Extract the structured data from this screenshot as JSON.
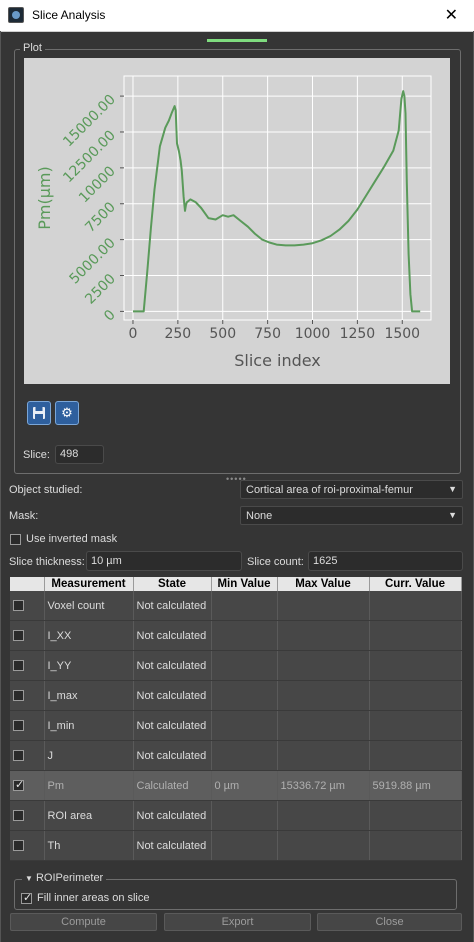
{
  "window": {
    "title": "Slice Analysis",
    "close_glyph": "✕"
  },
  "plot": {
    "group_title": "Plot",
    "slice_label": "Slice:",
    "slice_value": "498",
    "save_icon": "save-icon",
    "settings_icon": "gear-icon"
  },
  "chart_data": {
    "type": "line",
    "xlabel": "Slice index",
    "ylabel": "Pm(µm)",
    "xlim": [
      -50,
      1660
    ],
    "ylim": [
      -600,
      16400
    ],
    "x_ticks": [
      0,
      250,
      500,
      750,
      1000,
      1250,
      1500
    ],
    "y_ticks": [
      0,
      2500,
      5000,
      7500,
      10000,
      12500,
      15000
    ],
    "y_tick_labels": [
      "0",
      "2500",
      "5000.00",
      "7500",
      "10000",
      "12500.00",
      "15000.00"
    ],
    "grid": true,
    "color": "#5a9a5a",
    "series": [
      {
        "x": [
          0,
          60,
          80,
          100,
          120,
          150,
          180,
          200,
          215,
          225,
          232,
          238,
          245,
          255,
          265,
          272,
          282,
          290,
          295,
          300,
          320,
          350,
          380,
          420,
          460,
          500,
          530,
          560,
          600,
          640,
          680,
          720,
          760,
          800,
          850,
          900,
          950,
          1000,
          1050,
          1100,
          1150,
          1200,
          1250,
          1300,
          1350,
          1400,
          1450,
          1480,
          1495,
          1505,
          1512,
          1518,
          1525,
          1535,
          1545,
          1555,
          1565,
          1575,
          1600
        ],
        "y": [
          0,
          0,
          2800,
          5800,
          8500,
          11500,
          12800,
          13300,
          13800,
          14100,
          14300,
          14000,
          11700,
          11200,
          10500,
          9800,
          8000,
          7000,
          7400,
          7600,
          7800,
          7600,
          7200,
          6500,
          6400,
          6700,
          6600,
          6700,
          6300,
          5900,
          5400,
          5000,
          4800,
          4650,
          4600,
          4600,
          4650,
          4750,
          4950,
          5250,
          5700,
          6300,
          7100,
          8100,
          9100,
          10100,
          11200,
          12600,
          14800,
          15350,
          15000,
          13800,
          9000,
          4000,
          1200,
          0,
          0,
          0,
          0
        ]
      }
    ]
  },
  "controls": {
    "object_label": "Object studied:",
    "object_value": "Cortical area of roi-proximal-femur",
    "mask_label": "Mask:",
    "mask_value": "None",
    "inverted_label": "Use inverted mask",
    "thickness_label": "Slice thickness:",
    "thickness_value": "10 µm",
    "count_label": "Slice count:",
    "count_value": "1625"
  },
  "table": {
    "headers": [
      "Measurement",
      "State",
      "Min Value",
      "Max Value",
      "Curr. Value"
    ],
    "rows": [
      {
        "checked": false,
        "name": "Voxel count",
        "state": "Not calculated",
        "min": "",
        "max": "",
        "curr": ""
      },
      {
        "checked": false,
        "name": "I_XX",
        "state": "Not calculated",
        "min": "",
        "max": "",
        "curr": ""
      },
      {
        "checked": false,
        "name": "I_YY",
        "state": "Not calculated",
        "min": "",
        "max": "",
        "curr": ""
      },
      {
        "checked": false,
        "name": "I_max",
        "state": "Not calculated",
        "min": "",
        "max": "",
        "curr": ""
      },
      {
        "checked": false,
        "name": "I_min",
        "state": "Not calculated",
        "min": "",
        "max": "",
        "curr": ""
      },
      {
        "checked": false,
        "name": "J",
        "state": "Not calculated",
        "min": "",
        "max": "",
        "curr": ""
      },
      {
        "checked": true,
        "name": "Pm",
        "state": "Calculated",
        "min": "0 µm",
        "max": "15336.72 µm",
        "curr": "5919.88 µm"
      },
      {
        "checked": false,
        "name": "ROI area",
        "state": "Not calculated",
        "min": "",
        "max": "",
        "curr": ""
      },
      {
        "checked": false,
        "name": "Th",
        "state": "Not calculated",
        "min": "",
        "max": "",
        "curr": ""
      }
    ]
  },
  "roi": {
    "group_title": "ROIPerimeter",
    "fill_label": "Fill inner areas on slice",
    "fill_checked": true
  },
  "buttons": {
    "compute": "Compute",
    "export": "Export",
    "close": "Close"
  }
}
